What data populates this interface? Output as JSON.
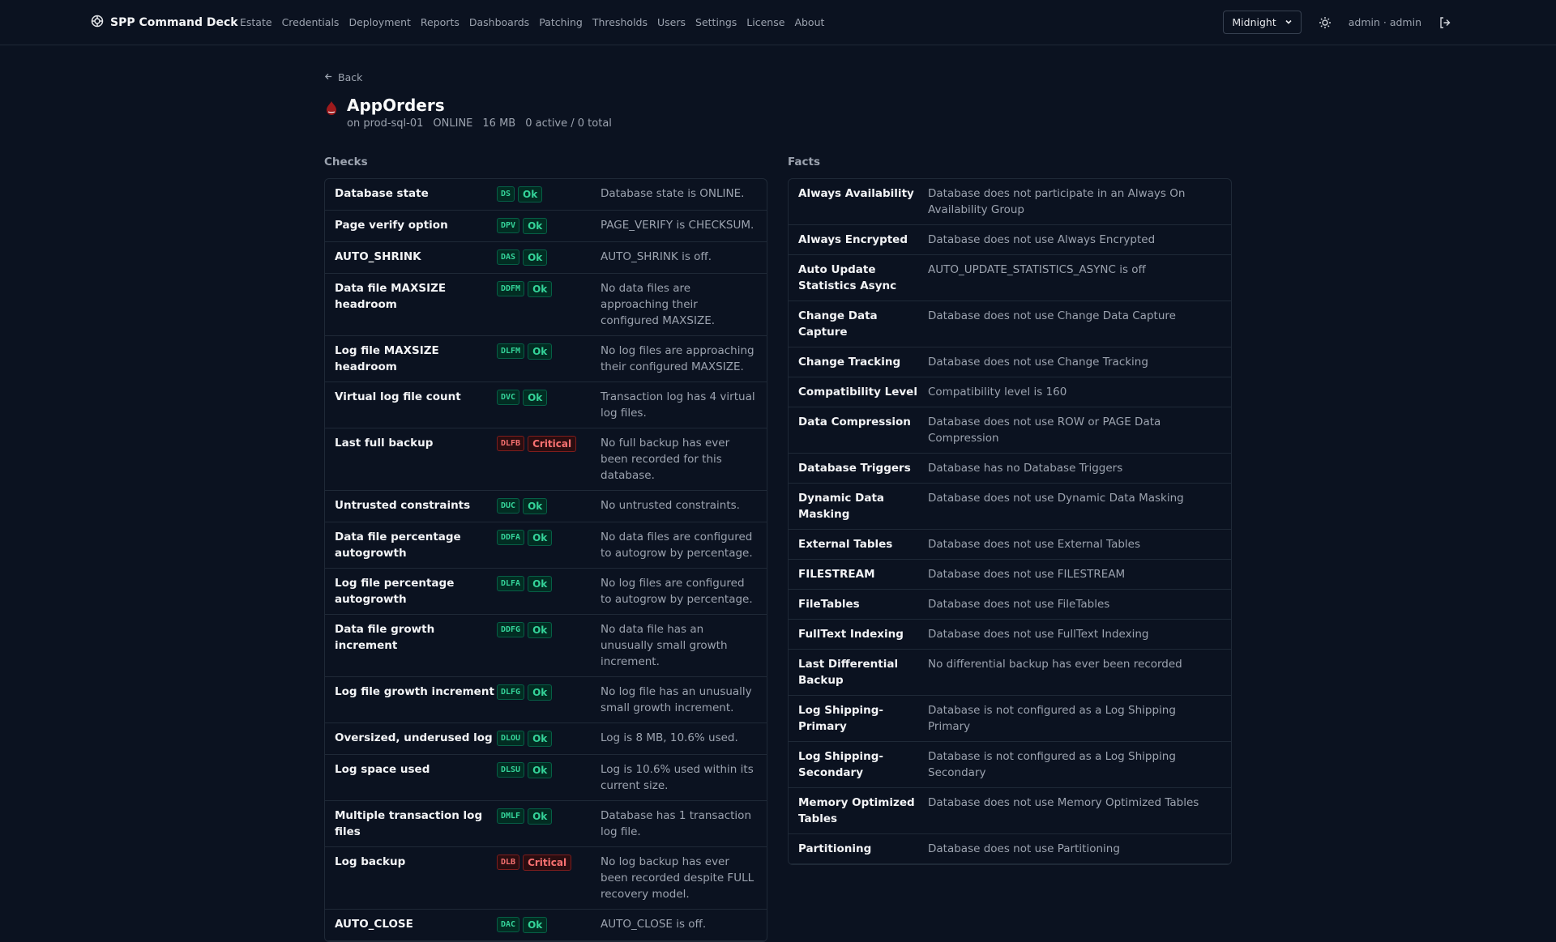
{
  "app": {
    "title": "SPP Command Deck"
  },
  "nav": [
    "Estate",
    "Credentials",
    "Deployment",
    "Reports",
    "Dashboards",
    "Patching",
    "Thresholds",
    "Users",
    "Settings",
    "License",
    "About"
  ],
  "header_right": {
    "theme": "Midnight",
    "user": "admin · admin"
  },
  "back_label": "Back",
  "database": {
    "name": "AppOrders",
    "server": "on prod-sql-01",
    "state": "ONLINE",
    "size": "16 MB",
    "sessions": "0 active / 0 total"
  },
  "checks_title": "Checks",
  "facts_title": "Facts",
  "checks": [
    {
      "name": "Database state",
      "code": "DS",
      "status": "Ok",
      "detail": "Database state is ONLINE."
    },
    {
      "name": "Page verify option",
      "code": "DPV",
      "status": "Ok",
      "detail": "PAGE_VERIFY is CHECKSUM."
    },
    {
      "name": "AUTO_SHRINK",
      "code": "DAS",
      "status": "Ok",
      "detail": "AUTO_SHRINK is off."
    },
    {
      "name": "Data file MAXSIZE headroom",
      "code": "DDFM",
      "status": "Ok",
      "detail": "No data files are approaching their configured MAXSIZE."
    },
    {
      "name": "Log file MAXSIZE headroom",
      "code": "DLFM",
      "status": "Ok",
      "detail": "No log files are approaching their configured MAXSIZE."
    },
    {
      "name": "Virtual log file count",
      "code": "DVC",
      "status": "Ok",
      "detail": "Transaction log has 4 virtual log files."
    },
    {
      "name": "Last full backup",
      "code": "DLFB",
      "status": "Critical",
      "detail": "No full backup has ever been recorded for this database."
    },
    {
      "name": "Untrusted constraints",
      "code": "DUC",
      "status": "Ok",
      "detail": "No untrusted constraints."
    },
    {
      "name": "Data file percentage autogrowth",
      "code": "DDFA",
      "status": "Ok",
      "detail": "No data files are configured to autogrow by percentage."
    },
    {
      "name": "Log file percentage autogrowth",
      "code": "DLFA",
      "status": "Ok",
      "detail": "No log files are configured to autogrow by percentage."
    },
    {
      "name": "Data file growth increment",
      "code": "DDFG",
      "status": "Ok",
      "detail": "No data file has an unusually small growth increment."
    },
    {
      "name": "Log file growth increment",
      "code": "DLFG",
      "status": "Ok",
      "detail": "No log file has an unusually small growth increment."
    },
    {
      "name": "Oversized, underused log",
      "code": "DLOU",
      "status": "Ok",
      "detail": "Log is 8 MB, 10.6% used."
    },
    {
      "name": "Log space used",
      "code": "DLSU",
      "status": "Ok",
      "detail": "Log is 10.6% used within its current size."
    },
    {
      "name": "Multiple transaction log files",
      "code": "DMLF",
      "status": "Ok",
      "detail": "Database has 1 transaction log file."
    },
    {
      "name": "Log backup",
      "code": "DLB",
      "status": "Critical",
      "detail": "No log backup has ever been recorded despite FULL recovery model."
    },
    {
      "name": "AUTO_CLOSE",
      "code": "DAC",
      "status": "Ok",
      "detail": "AUTO_CLOSE is off."
    }
  ],
  "facts": [
    {
      "name": "Always Availability",
      "value": "Database does not participate in an Always On Availability Group"
    },
    {
      "name": "Always Encrypted",
      "value": "Database does not use Always Encrypted"
    },
    {
      "name": "Auto Update Statistics Async",
      "value": "AUTO_UPDATE_STATISTICS_ASYNC is off"
    },
    {
      "name": "Change Data Capture",
      "value": "Database does not use Change Data Capture"
    },
    {
      "name": "Change Tracking",
      "value": "Database does not use Change Tracking"
    },
    {
      "name": "Compatibility Level",
      "value": "Compatibility level is 160"
    },
    {
      "name": "Data Compression",
      "value": "Database does not use ROW or PAGE Data Compression"
    },
    {
      "name": "Database Triggers",
      "value": "Database has no Database Triggers"
    },
    {
      "name": "Dynamic Data Masking",
      "value": "Database does not use Dynamic Data Masking"
    },
    {
      "name": "External Tables",
      "value": "Database does not use External Tables"
    },
    {
      "name": "FILESTREAM",
      "value": "Database does not use FILESTREAM"
    },
    {
      "name": "FileTables",
      "value": "Database does not use FileTables"
    },
    {
      "name": "FullText Indexing",
      "value": "Database does not use FullText Indexing"
    },
    {
      "name": "Last Differential Backup",
      "value": "No differential backup has ever been recorded"
    },
    {
      "name": "Log Shipping-Primary",
      "value": "Database is not configured as a Log Shipping Primary"
    },
    {
      "name": "Log Shipping-Secondary",
      "value": "Database is not configured as a Log Shipping Secondary"
    },
    {
      "name": "Memory Optimized Tables",
      "value": "Database does not use Memory Optimized Tables"
    },
    {
      "name": "Partitioning",
      "value": "Database does not use Partitioning"
    }
  ]
}
